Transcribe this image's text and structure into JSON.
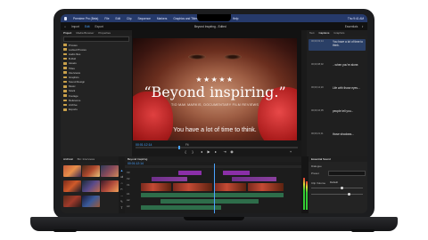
{
  "menubar": {
    "app": "Premiere Pro (Beta)",
    "items": [
      "File",
      "Edit",
      "Clip",
      "Sequence",
      "Markers",
      "Graphics and Titles",
      "View",
      "Window",
      "Help"
    ],
    "right": [
      "Thu 9:41 AM"
    ]
  },
  "workspace": {
    "tabs": [
      "Import",
      "Edit",
      "Export"
    ],
    "active_tab": "Edit",
    "file_title": "Beyond Inspiring - Edited",
    "right": [
      "Essentials"
    ]
  },
  "project_panel": {
    "tabs": [
      "Project",
      "Media Browser",
      "Properties"
    ],
    "search_placeholder": "",
    "items": [
      "Proxies",
      "Locked Proxies",
      "Audio files",
      "B-Roll",
      "Assets",
      "Titles",
      "Interviews",
      "Graphics",
      "Sound Design",
      "Music",
      "Stock",
      "Footage",
      "Reference",
      "Archive",
      "Exports"
    ]
  },
  "program": {
    "stars": "★★★★★",
    "headline": "“Beyond inspiring.”",
    "subline": "TIO MAK MARKIS, DOCUMENTARY FILM REVIEWS",
    "caption": "You have a lot of time to think.",
    "timecode": "00:01:12:14",
    "fit": "Fit"
  },
  "transcript": {
    "tabs": [
      "Text",
      "Captions",
      "Graphics"
    ],
    "rows": [
      {
        "tc": "00;00;03;14",
        "text": "You have a lot of time to think."
      },
      {
        "tc": "00;00;08;02",
        "text": "...when you're alone."
      },
      {
        "tc": "00;00;12;20",
        "text": "Life with those eyes..."
      },
      {
        "tc": "00;00;16;05",
        "text": "people tell you..."
      },
      {
        "tc": "00;00;21;11",
        "text": "those shadows..."
      }
    ]
  },
  "bin": {
    "tabs": [
      "Archival",
      "Bin: Interviews"
    ]
  },
  "timeline": {
    "sequence": "Beyond Inspiring",
    "timecode": "00:01:12:14",
    "tracks": [
      "V3",
      "V2",
      "V1",
      "A1",
      "A2",
      "A3"
    ]
  },
  "essential_sound": {
    "title": "Essential Sound",
    "preset_label": "Preset",
    "preset_value": "Default",
    "level_label": "Clip Volume",
    "tag": "Dialogue"
  }
}
